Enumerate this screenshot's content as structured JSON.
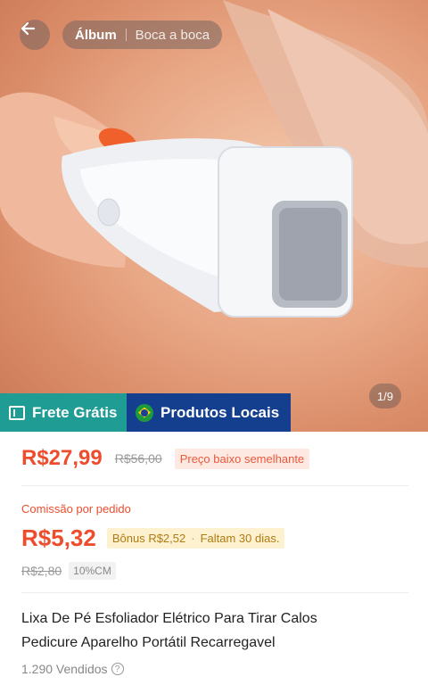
{
  "header": {
    "back_icon": "arrow-left-icon",
    "tabs": [
      {
        "label": "Álbum",
        "active": true
      },
      {
        "label": "Boca a boca",
        "active": false
      }
    ]
  },
  "gallery": {
    "counter": "1/9"
  },
  "badges": {
    "free_shipping": "Frete Grátis",
    "local": "Produtos Locais"
  },
  "pricing": {
    "price": "R$27,99",
    "old_price": "R$56,00",
    "tag": "Preço baixo semelhante"
  },
  "commission": {
    "label": "Comissão por pedido",
    "value": "R$5,32",
    "bonus": "Bônus R$2,52",
    "days_left": "Faltam 30 dias.",
    "old_value": "R$2,80",
    "rate": "10%CM"
  },
  "product": {
    "title_line1": "Lixa De Pé Esfoliador Elétrico Para Tirar Calos",
    "title_line2": "Pedicure Aparelho Portátil Recarregavel",
    "sold": "1.290 Vendidos"
  },
  "colors": {
    "accent": "#ee4d2d",
    "free_badge": "#1f9c93",
    "local_badge": "#143f8f"
  }
}
